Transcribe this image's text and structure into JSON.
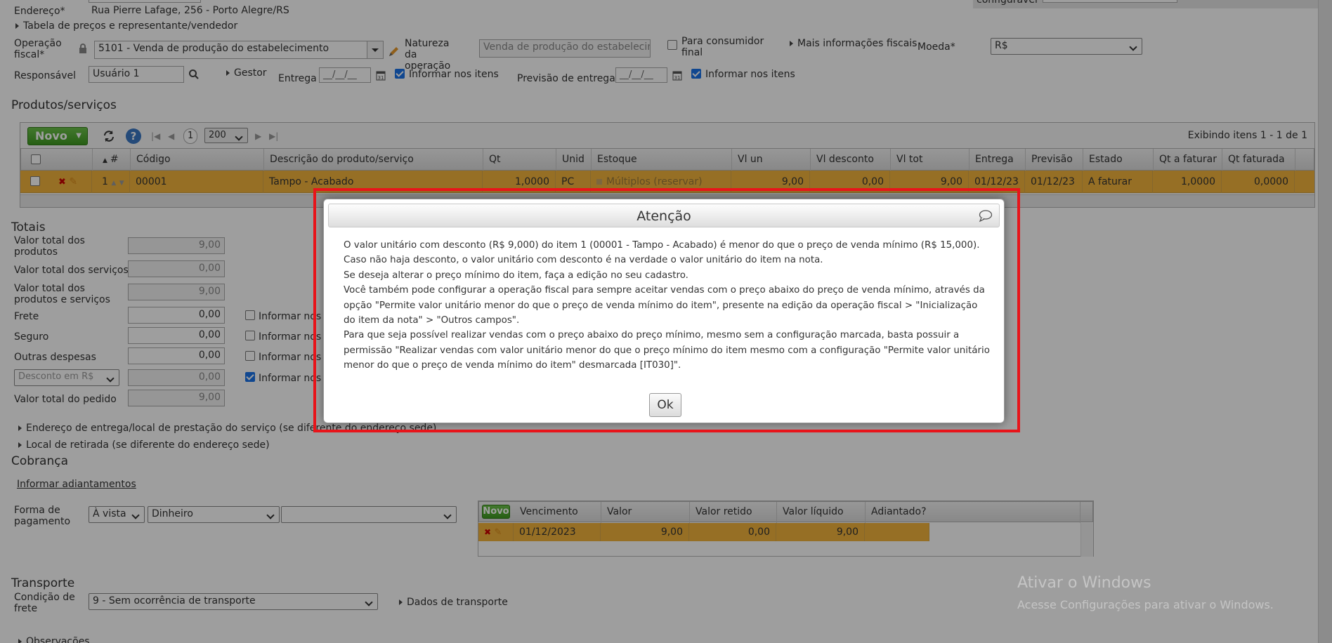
{
  "header": {
    "endereco_label": "Endereço*",
    "endereco_value": "Rua Pierre Lafage, 256 - Porto Alegre/RS",
    "configuravel_label": "configurável",
    "tabela_link": "Tabela de preços e representante/vendedor",
    "operacao_label": "Operação fiscal*",
    "operacao_value": "5101 - Venda de produção do estabelecimento",
    "natureza_label": "Natureza da operação",
    "natureza_value": "Venda de produção do estabelecim",
    "consumidor_label": "Para consumidor final",
    "mais_info": "Mais informações fiscais",
    "moeda_label": "Moeda*",
    "moeda_value": "R$",
    "responsavel_label": "Responsável",
    "responsavel_value": "Usuário 1",
    "gestor": "Gestor",
    "entrega_label": "Entrega",
    "entrega_placeholder": "__/__/__",
    "informar_itens_1": "Informar nos itens",
    "previsao_label": "Previsão de entrega",
    "previsao_placeholder": "__/__/__",
    "informar_itens_2": "Informar nos itens"
  },
  "produtos": {
    "title": "Produtos/serviços",
    "novo": "Novo",
    "page": "1",
    "page_size": "200",
    "exibindo": "Exibindo itens 1 - 1 de 1",
    "columns": [
      "#",
      "Código",
      "Descrição do produto/serviço",
      "Qt",
      "Unid",
      "Estoque",
      "Vl un",
      "Vl desconto",
      "Vl tot",
      "Entrega",
      "Previsão",
      "Estado",
      "Qt a faturar",
      "Qt faturada"
    ],
    "row": {
      "num": "1",
      "codigo": "00001",
      "descricao": "Tampo - Acabado",
      "qt": "1,0000",
      "unid": "PC",
      "estoque": "Múltiplos (reservar)",
      "vl_un": "9,00",
      "vl_desconto": "0,00",
      "vl_tot": "9,00",
      "entrega": "01/12/23",
      "previsao": "01/12/23",
      "estado": "A faturar",
      "qt_a_faturar": "1,0000",
      "qt_faturada": "0,0000"
    }
  },
  "totais": {
    "title": "Totais",
    "valor_produtos_label": "Valor total dos produtos",
    "valor_produtos": "9,00",
    "valor_servicos_label": "Valor total dos serviços",
    "valor_servicos": "0,00",
    "valor_prod_serv_label": "Valor total dos produtos e serviços",
    "valor_prod_serv": "9,00",
    "frete_label": "Frete",
    "frete": "0,00",
    "seguro_label": "Seguro",
    "seguro": "0,00",
    "outras_label": "Outras despesas",
    "outras": "0,00",
    "desconto_sel": "Desconto em R$",
    "desconto": "0,00",
    "valor_pedido_label": "Valor total do pedido",
    "valor_pedido": "9,00",
    "informar_nos": "Informar nos"
  },
  "links": {
    "endereco_entrega": "Endereço de entrega/local de prestação do serviço (se diferente do endereço sede)",
    "local_retirada": "Local de retirada (se diferente do endereço sede)"
  },
  "cobranca": {
    "title": "Cobrança",
    "informar_adiantamentos": "Informar adiantamentos",
    "forma_label": "Forma de pagamento",
    "forma_1": "À vista",
    "forma_2": "Dinheiro",
    "forma_3": "",
    "novo": "Novo",
    "columns": [
      "Vencimento",
      "Valor",
      "Valor retido",
      "Valor líquido",
      "Adiantado?"
    ],
    "row": {
      "vencimento": "01/12/2023",
      "valor": "9,00",
      "retido": "0,00",
      "liquido": "9,00",
      "adiantado": ""
    }
  },
  "transporte": {
    "title": "Transporte",
    "condicao_label": "Condição de frete",
    "condicao_value": "9 - Sem ocorrência de transporte",
    "dados": "Dados de transporte",
    "observacoes": "Observações"
  },
  "watermark": {
    "line1": "Ativar o Windows",
    "line2": "Acesse Configurações para ativar o Windows."
  },
  "dialog": {
    "title": "Atenção",
    "p1": "O valor unitário com desconto (R$ 9,000) do item 1 (00001 - Tampo - Acabado) é menor do que o preço de venda mínimo (R$ 15,000).",
    "p2": "Caso não haja desconto, o valor unitário com desconto é na verdade o valor unitário do item na nota.",
    "p3": "Se deseja alterar o preço mínimo do item, faça a edição no seu cadastro.",
    "p4": "Você também pode configurar a operação fiscal para sempre aceitar vendas com o preço abaixo do preço de venda mínimo, através da opção \"Permite valor unitário menor do que o preço de venda mínimo do item\", presente na edição da operação fiscal > \"Inicialização do item da nota\" > \"Outros campos\".",
    "p5": "Para que seja possível realizar vendas com o preço abaixo do preço mínimo, mesmo sem a configuração marcada, basta possuir a permissão \"Realizar vendas com valor unitário menor do que o preço mínimo do item mesmo com a configuração \"Permite valor unitário menor do que o preço de venda mínimo do item\" desmarcada [IT030]\".",
    "ok": "Ok"
  },
  "colors": {
    "accent_row": "#f2b43c",
    "green": "#4ea82e",
    "alert_border": "#e8141a"
  }
}
